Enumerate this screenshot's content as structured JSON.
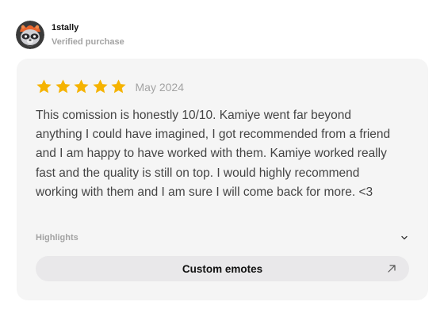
{
  "reviewer": {
    "username": "1stally",
    "badge": "Verified purchase",
    "avatar_icon": "raccoon-avatar-icon"
  },
  "review": {
    "rating": 5,
    "rating_max": 5,
    "star_color": "#f5b301",
    "date": "May 2024",
    "text": "This comission is honestly 10/10. Kamiye went far beyond anything I could have imagined, I got recommended from a friend and I am happy to have worked with them. Kamiye worked really fast and the quality is still on top. I would highly recommend working with them and I am sure I will come back for more. <3"
  },
  "highlights": {
    "label": "Highlights",
    "toggle_icon": "chevron-down-icon"
  },
  "tag": {
    "label": "Custom emotes",
    "icon": "arrow-up-right-icon"
  }
}
